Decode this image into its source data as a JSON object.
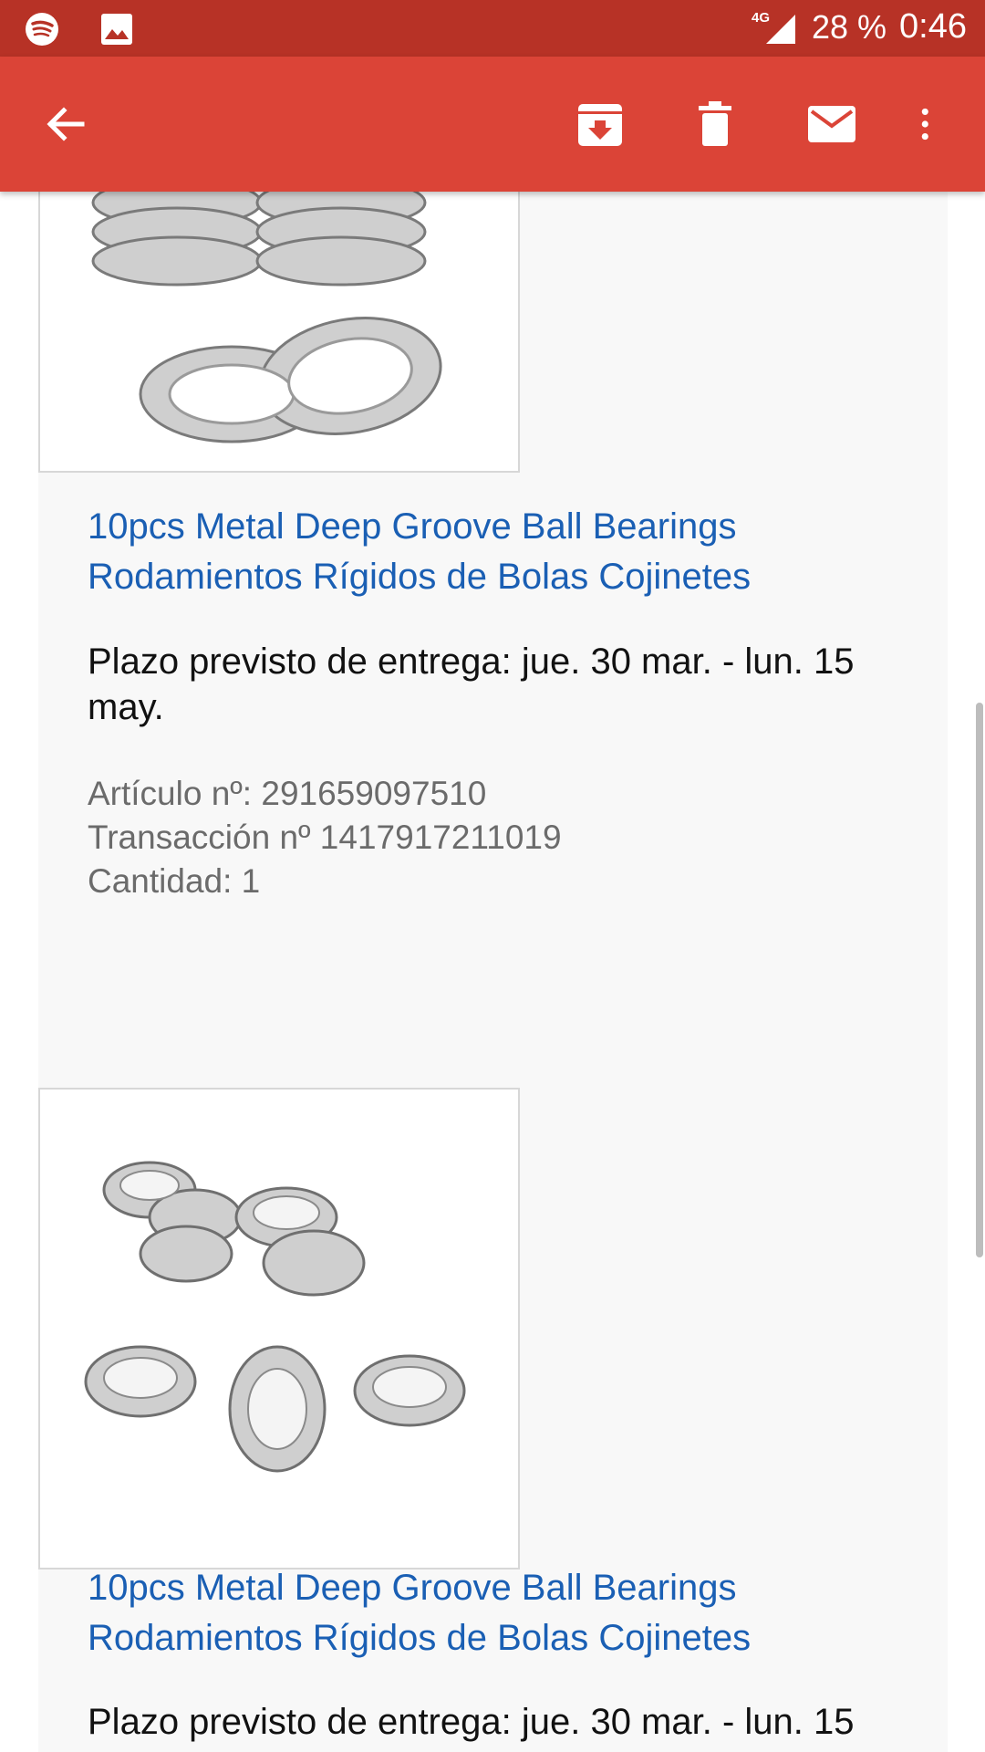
{
  "status_bar": {
    "network": "4G",
    "battery": "28 %",
    "time": "0:46",
    "icons": [
      "spotify-icon",
      "image-icon",
      "signal-icon"
    ]
  },
  "toolbar": {
    "icons": [
      "back-arrow-icon",
      "archive-icon",
      "trash-icon",
      "mail-icon",
      "more-vert-icon"
    ],
    "color": "#db4437"
  },
  "items": [
    {
      "title_line1": "10pcs Metal Deep Groove Ball Bearings",
      "title_line2": "Rodamientos Rígidos de Bolas Cojinetes",
      "delivery_line1": "Plazo previsto de entrega: jue. 30 mar. - lun. 15",
      "delivery_line2": "may.",
      "article": "Artículo nº: 291659097510",
      "transaction": "Transacción nº 1417917211019",
      "quantity": "Cantidad: 1"
    },
    {
      "title_line1": "10pcs Metal Deep Groove Ball Bearings",
      "title_line2": "Rodamientos Rígidos de Bolas Cojinetes",
      "delivery_line1": "Plazo previsto de entrega: jue. 30 mar. - lun. 15"
    }
  ]
}
